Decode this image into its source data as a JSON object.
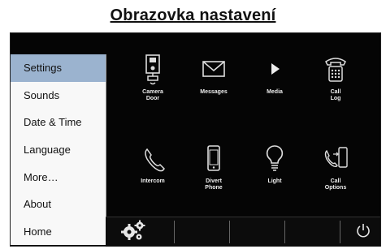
{
  "page": {
    "title": "Obrazovka nastavení"
  },
  "sidebar": {
    "items": [
      {
        "label": "Settings",
        "active": true
      },
      {
        "label": "Sounds"
      },
      {
        "label": "Date & Time"
      },
      {
        "label": "Language"
      },
      {
        "label": "More…"
      },
      {
        "label": "About"
      },
      {
        "label": "Home"
      }
    ],
    "active_color": "#9bb3cf"
  },
  "apps": {
    "camera_door": {
      "label": "Camera\nDoor",
      "icon": "camera-door-icon"
    },
    "messages": {
      "label": "Messages",
      "icon": "envelope-icon"
    },
    "media": {
      "label": "Media",
      "icon": "play-icon"
    },
    "call_log": {
      "label": "Call\nLog",
      "icon": "phone-keypad-icon"
    },
    "intercom": {
      "label": "Intercom",
      "icon": "handset-icon"
    },
    "divert_phone": {
      "label": "Divert\nPhone",
      "icon": "mobile-phone-icon"
    },
    "light": {
      "label": "Light",
      "icon": "lightbulb-icon"
    },
    "call_options": {
      "label": "Call\nOptions",
      "icon": "call-transfer-icon"
    }
  },
  "bottom_bar": {
    "settings_icon": "gears-icon",
    "power_icon": "power-icon"
  }
}
